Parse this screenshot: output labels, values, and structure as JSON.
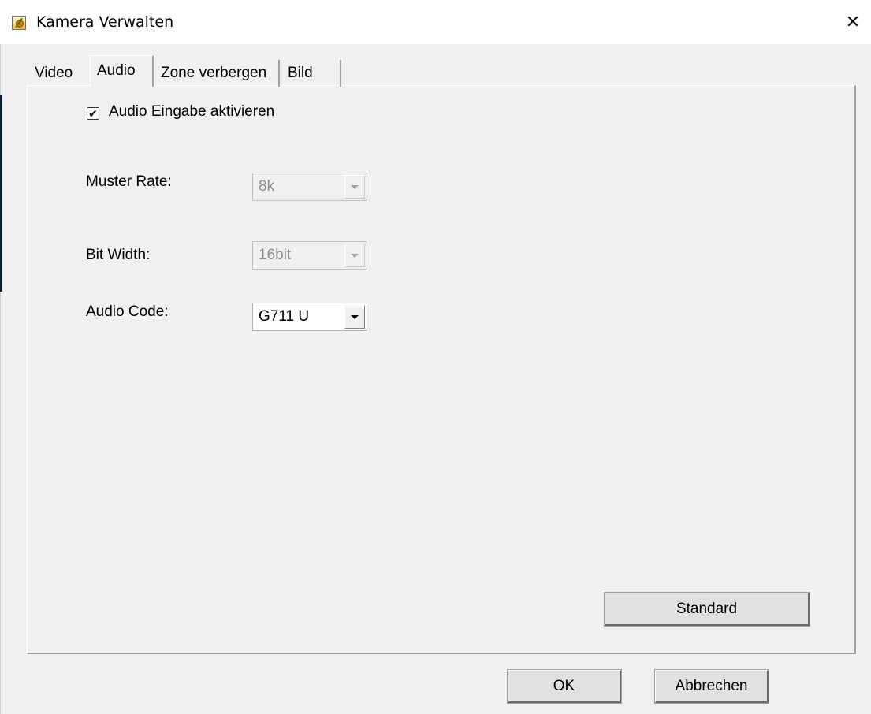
{
  "window": {
    "title": "Kamera Verwalten",
    "close_glyph": "✕",
    "icon": "camera-app-icon"
  },
  "tabs": [
    {
      "label": "Video",
      "active": false
    },
    {
      "label": "Audio",
      "active": true
    },
    {
      "label": "Zone verbergen",
      "active": false
    },
    {
      "label": "Bild",
      "active": false
    }
  ],
  "audio": {
    "enable_checkbox": {
      "label": "Audio Eingabe aktivieren",
      "checked": true,
      "mark": "✔"
    },
    "sample_rate": {
      "label": "Muster Rate:",
      "value": "8k",
      "enabled": false
    },
    "bit_width": {
      "label": "Bit Width:",
      "value": "16bit",
      "enabled": false
    },
    "audio_code": {
      "label": "Audio Code:",
      "value": "G711 U",
      "enabled": true
    }
  },
  "buttons": {
    "standard": "Standard",
    "ok": "OK",
    "cancel": "Abbrechen"
  },
  "colors": {
    "background": "#f0f0f0",
    "titlebar": "#ffffff",
    "disabled_text": "#8c8c8c"
  }
}
